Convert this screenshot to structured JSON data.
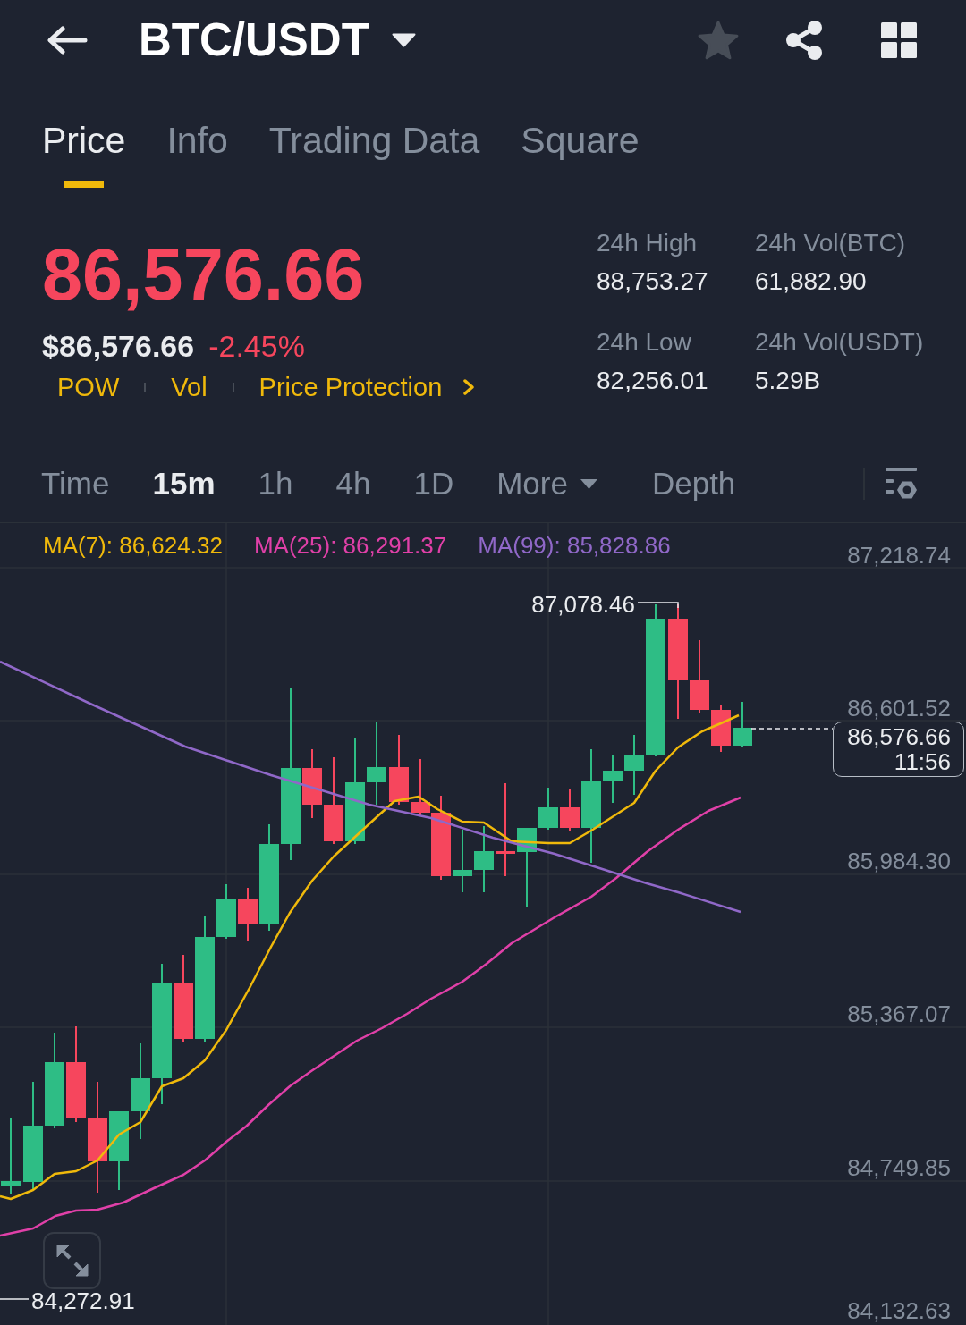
{
  "header": {
    "title": "BTC/USDT"
  },
  "tabs": [
    {
      "label": "Price",
      "selected": true
    },
    {
      "label": "Info",
      "selected": false
    },
    {
      "label": "Trading Data",
      "selected": false
    },
    {
      "label": "Square",
      "selected": false
    }
  ],
  "ticker": {
    "last_price": "86,576.66",
    "falling": true,
    "last_price_usd": "$86,576.66",
    "change": "-2.45%",
    "tags": [
      {
        "label": "POW",
        "kind": "tag"
      },
      {
        "label": "Vol",
        "kind": "tag"
      },
      {
        "label": "Price Protection",
        "kind": "link"
      }
    ],
    "stats": [
      {
        "label": "24h High",
        "value": "88,753.27"
      },
      {
        "label": "24h Vol(BTC)",
        "value": "61,882.90"
      },
      {
        "label": "24h Low",
        "value": "82,256.01"
      },
      {
        "label": "24h Vol(USDT)",
        "value": "5.29B"
      }
    ]
  },
  "intervals": [
    {
      "label": "Time",
      "kind": "interval",
      "selected": false
    },
    {
      "label": "15m",
      "kind": "interval",
      "selected": true
    },
    {
      "label": "1h",
      "kind": "interval",
      "selected": false
    },
    {
      "label": "4h",
      "kind": "interval",
      "selected": false
    },
    {
      "label": "1D",
      "kind": "interval",
      "selected": false
    },
    {
      "label": "More",
      "kind": "menu",
      "selected": false
    },
    {
      "label": "Depth",
      "kind": "view",
      "selected": false
    }
  ],
  "chart": {
    "moving_averages": [
      {
        "label": "MA(7): 86,624.32",
        "color": "#f0b90b"
      },
      {
        "label": "MA(25): 86,291.37",
        "color": "#e040a8"
      },
      {
        "label": "MA(99): 85,828.86",
        "color": "#9068c8"
      }
    ],
    "price_labels": [
      "87,218.74",
      "86,601.52",
      "85,984.30",
      "85,367.07",
      "84,749.85",
      "84,132.63"
    ],
    "high_label": "87,078.46",
    "low_label": "84,272.91",
    "current_price": "86,576.66",
    "countdown": "11:56"
  }
}
